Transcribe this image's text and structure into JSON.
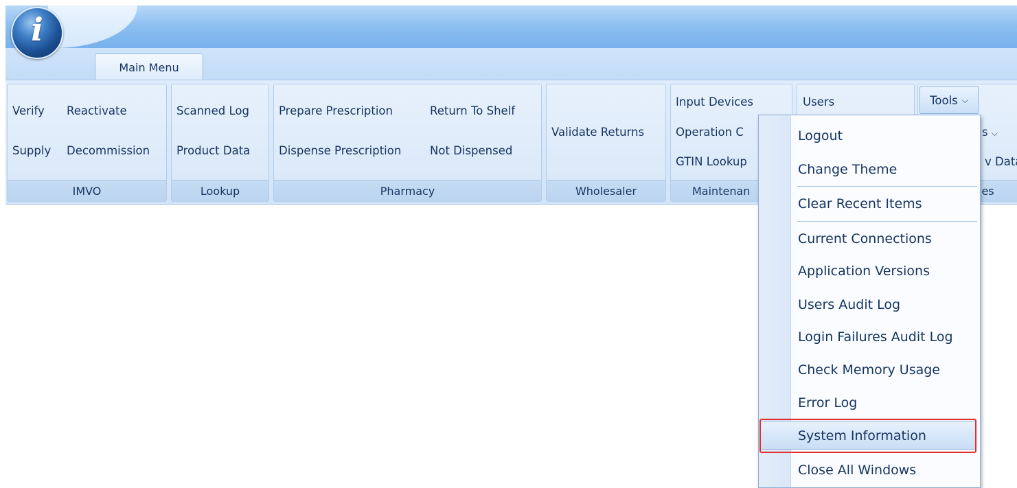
{
  "tabs": [
    {
      "label": "Main Menu"
    }
  ],
  "ribbon": {
    "groups": [
      {
        "label": "IMVO",
        "commands": [
          "Verify",
          "Reactivate",
          "Supply",
          "Decommission"
        ]
      },
      {
        "label": "Lookup",
        "commands": [
          "Scanned Log",
          "Product Data"
        ]
      },
      {
        "label": "Pharmacy",
        "commands": [
          "Prepare Prescription",
          "Return To Shelf",
          "Dispense Prescription",
          "Not Dispensed"
        ]
      },
      {
        "label": "Wholesaler",
        "commands": [
          "Validate Returns"
        ]
      },
      {
        "label": "Maintenan",
        "commands": [
          "Input Devices",
          "Operation C",
          "GTIN Lookup"
        ]
      },
      {
        "label": "",
        "commands": [
          "Users"
        ]
      },
      {
        "label": "ies",
        "commands": [
          "Tools",
          "s",
          "v Data"
        ]
      }
    ]
  },
  "tools_menu": {
    "button_label": "Tools",
    "items": [
      "Logout",
      "Change Theme",
      "Clear Recent Items",
      "Current Connections",
      "Application Versions",
      "Users Audit Log",
      "Login Failures Audit Log",
      "Check Memory Usage",
      "Error Log",
      "System Information",
      "Close All Windows"
    ],
    "highlighted_item": "System Information"
  },
  "app_orb": {
    "glyph": "i"
  },
  "colors": {
    "accent": "#77b1ec",
    "highlight_outline": "#e03030",
    "text": "#15345f"
  }
}
